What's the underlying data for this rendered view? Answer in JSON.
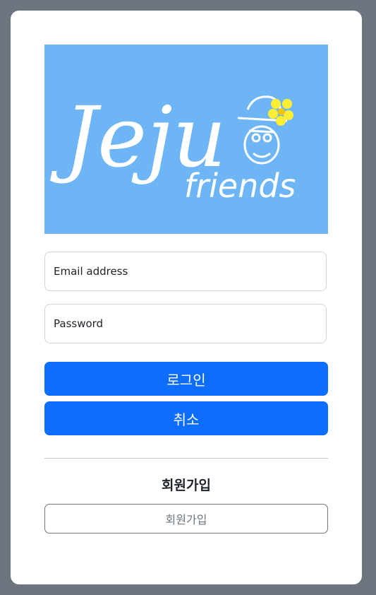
{
  "logo": {
    "line1": "Jeju",
    "line2": "friends",
    "background_color": "#6db5f4",
    "flower_color": "#ffee33"
  },
  "form": {
    "email_placeholder": "Email address",
    "password_placeholder": "Password",
    "login_label": "로그인",
    "cancel_label": "취소"
  },
  "signup": {
    "heading": "회원가입",
    "button_label": "회원가입"
  },
  "colors": {
    "page_background": "#6c757d",
    "primary": "#0d6efd",
    "secondary": "#6c757d"
  }
}
